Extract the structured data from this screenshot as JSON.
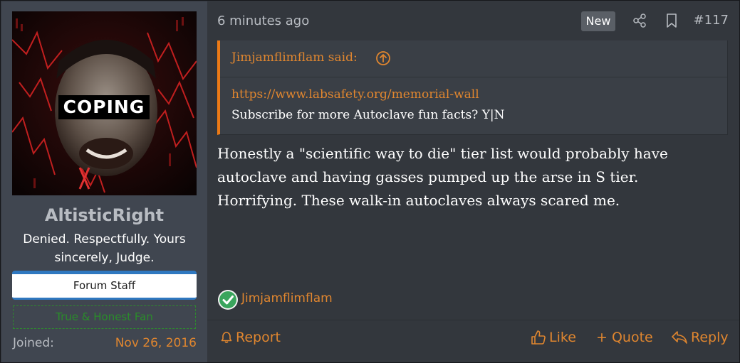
{
  "avatar": {
    "caption": "COPING"
  },
  "user": {
    "username": "AltisticRight",
    "title": "Denied. Respectfully. Yours sincerely, Judge.",
    "banner_staff": "Forum Staff",
    "banner_fan": "True & Honest Fan",
    "joined_label": "Joined:",
    "joined_value": "Nov 26, 2016"
  },
  "post": {
    "time": "6 minutes ago",
    "new_badge": "New",
    "number": "#117",
    "quote": {
      "author": "Jimjamflimflam said:",
      "link": "https://www.labsafety.org/memorial-wall",
      "text": "Subscribe for more Autoclave fun facts? Y|N"
    },
    "body": "Honestly a \"scientific way to die\" tier list would probably have autoclave and having gasses pumped up the arse in S tier. Horrifying. These walk-in autoclaves always scared me.",
    "reaction_user": "Jimjamflimflam",
    "actions": {
      "report": "Report",
      "like": "Like",
      "quote": "+ Quote",
      "reply": "Reply"
    }
  },
  "colors": {
    "accent": "#e0862f",
    "quote_bar": "#ec7a16",
    "staff_banner": "#2f78c0",
    "fan_banner": "#2a8c2a",
    "reaction": "#3aa55d"
  },
  "icons": {
    "share": "share-icon",
    "bookmark": "bookmark-icon",
    "quote_jump": "arrow-up-circle-icon",
    "reaction": "checkmark-circle-icon",
    "report": "warning-icon",
    "like": "thumbs-up-icon",
    "reply": "reply-icon"
  }
}
